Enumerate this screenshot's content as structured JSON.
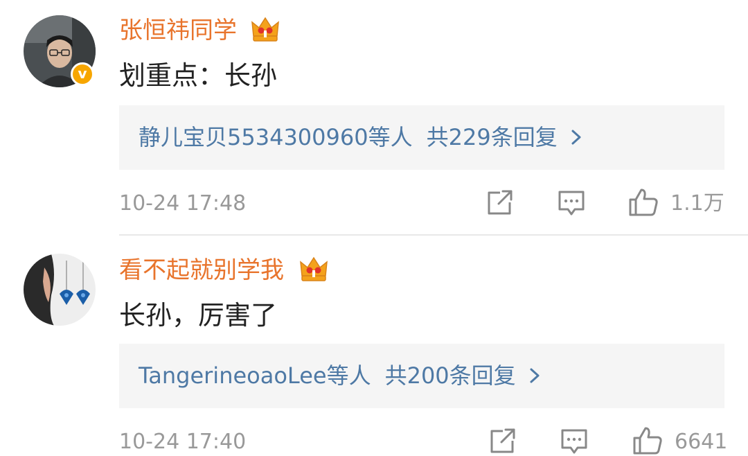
{
  "comments": [
    {
      "username": "张恒祎同学",
      "content": "划重点：长孙",
      "replies_preview": "静儿宝贝5534300960等人",
      "replies_total": "共229条回复",
      "timestamp": "10-24 17:48",
      "likes": "1.1万",
      "verified": true
    },
    {
      "username": "看不起就别学我",
      "content": "长孙，厉害了",
      "replies_preview": "TangerineoaoLee等人",
      "replies_total": "共200条回复",
      "timestamp": "10-24 17:40",
      "likes": "6641",
      "verified": false
    }
  ],
  "colors": {
    "username": "#e8742c",
    "reply_link": "#4e79a5",
    "meta_text": "#999999",
    "reply_bg": "#f5f5f5",
    "verified_badge": "#f7a600",
    "crown": "#f4a21b"
  },
  "icons": {
    "crown": "crown-icon",
    "forward": "share-icon",
    "comment": "comment-icon",
    "like": "thumbs-up-icon",
    "chevron": "chevron-right-icon"
  }
}
